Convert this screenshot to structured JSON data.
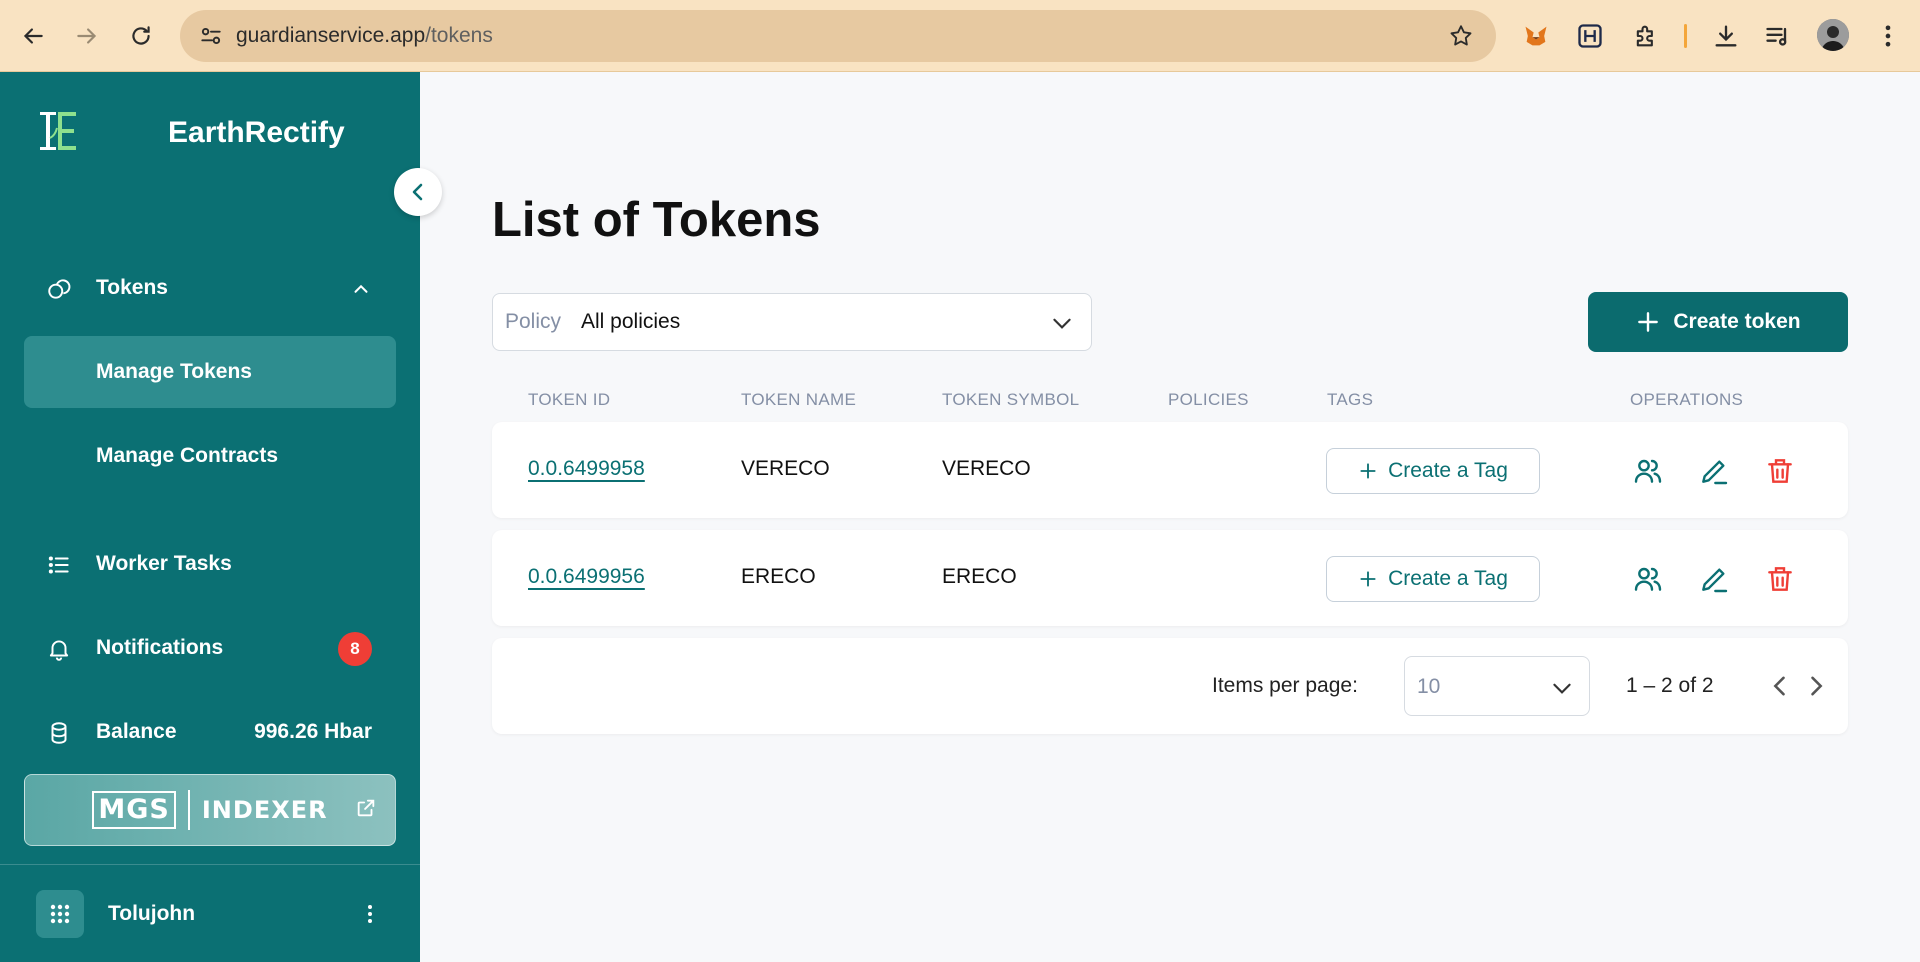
{
  "browser": {
    "url_host": "guardianservice.app",
    "url_path": "/tokens"
  },
  "sidebar": {
    "brand": "EarthRectify",
    "nav": {
      "tokens": "Tokens",
      "manage_tokens": "Manage Tokens",
      "manage_contracts": "Manage Contracts",
      "worker_tasks": "Worker Tasks",
      "notifications": "Notifications",
      "notifications_count": "8",
      "balance": "Balance",
      "balance_value": "996.26 Hbar"
    },
    "indexer": {
      "mgs": "MGS",
      "label": "INDEXER"
    },
    "user": {
      "name": "Tolujohn"
    }
  },
  "main": {
    "title": "List of Tokens",
    "policy_filter": {
      "label": "Policy",
      "value": "All policies"
    },
    "create_token_label": "Create token",
    "columns": [
      "TOKEN ID",
      "TOKEN NAME",
      "TOKEN SYMBOL",
      "POLICIES",
      "TAGS",
      "OPERATIONS"
    ],
    "rows": [
      {
        "token_id": "0.0.6499958",
        "token_name": "VERECO",
        "token_symbol": "VERECO",
        "policies": "",
        "tag_action": "Create a Tag"
      },
      {
        "token_id": "0.0.6499956",
        "token_name": "ERECO",
        "token_symbol": "ERECO",
        "policies": "",
        "tag_action": "Create a Tag"
      }
    ],
    "paginator": {
      "items_per_page_label": "Items per page:",
      "items_per_page_value": "10",
      "range": "1 – 2 of 2"
    }
  },
  "colors": {
    "sidebar_bg": "#0b7073",
    "accent": "#0b6b6e",
    "danger": "#ef3e36",
    "browser_bar": "#f9e3c2"
  }
}
